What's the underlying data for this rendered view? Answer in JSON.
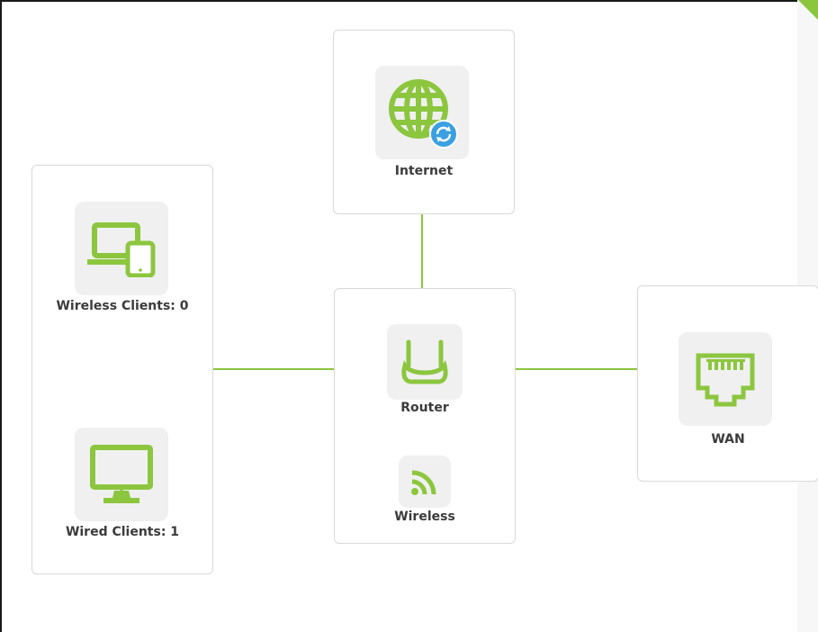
{
  "topology": {
    "internet": {
      "label": "Internet",
      "icon": "globe-icon"
    },
    "router": {
      "label": "Router",
      "icon": "router-icon"
    },
    "wireless": {
      "label": "Wireless",
      "icon": "wifi-icon"
    },
    "wan": {
      "label": "WAN",
      "icon": "ethernet-port-icon"
    },
    "wireless_clients": {
      "label": "Wireless Clients: 0",
      "icon": "devices-icon"
    },
    "wired_clients": {
      "label": "Wired Clients: 1",
      "icon": "monitor-icon"
    }
  },
  "colors": {
    "accent": "#8cc63f",
    "badge": "#3aa0e0",
    "tile": "#f0f0f0",
    "border": "#d9d9d9",
    "text": "#3b3b3b"
  }
}
